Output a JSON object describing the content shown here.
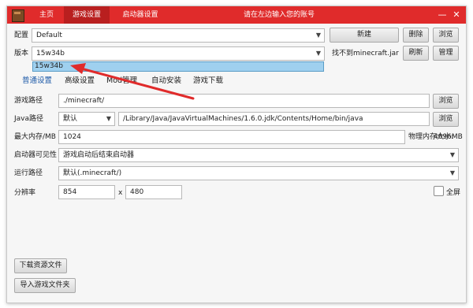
{
  "titlebar": {
    "tabs": [
      {
        "label": "主页"
      },
      {
        "label": "游戏设置"
      },
      {
        "label": "启动器设置"
      }
    ],
    "title": "请在左边输入您的账号",
    "minimize": "—",
    "close": "✕"
  },
  "config": {
    "label": "配置",
    "value": "Default",
    "new_button": "新建",
    "delete_button": "删除",
    "browse_button": "浏览"
  },
  "version": {
    "label": "版本",
    "value": "15w34b",
    "status": "找不到minecraft.jar",
    "refresh_button": "刷新",
    "manage_button": "管理",
    "dropdown_options": [
      "15w34b"
    ]
  },
  "subtabs": [
    {
      "label": "普通设置"
    },
    {
      "label": "高级设置"
    },
    {
      "label": "Mod管理"
    },
    {
      "label": "自动安装"
    },
    {
      "label": "游戏下载"
    }
  ],
  "settings": {
    "game_path": {
      "label": "游戏路径",
      "value": "./minecraft/",
      "button": "浏览"
    },
    "java_path": {
      "label": "Java路径",
      "mode": "默认",
      "value": "/Library/Java/JavaVirtualMachines/1.6.0.jdk/Contents/Home/bin/java",
      "button": "浏览"
    },
    "max_memory": {
      "label": "最大内存/MB",
      "value": "1024",
      "physical_label": "物理内存大小:",
      "physical_value": "4096MB"
    },
    "launcher_visibility": {
      "label": "启动器可见性",
      "value": "游戏启动后结束启动器"
    },
    "run_path": {
      "label": "运行路径",
      "value": "默认(.minecraft/)"
    },
    "resolution": {
      "label": "分辨率",
      "width": "854",
      "separator": "x",
      "height": "480",
      "fullscreen_label": "全屏"
    }
  },
  "bottom_buttons": {
    "download_assets": "下载资源文件",
    "import_folder": "导入游戏文件夹"
  },
  "colors": {
    "titlebar": "#e02b2b",
    "active_tab": "#b91f1f",
    "dropdown_highlight": "#9fd0ef",
    "subtab_active": "#1d5aa8",
    "annotation_arrow": "#e02b2b"
  }
}
